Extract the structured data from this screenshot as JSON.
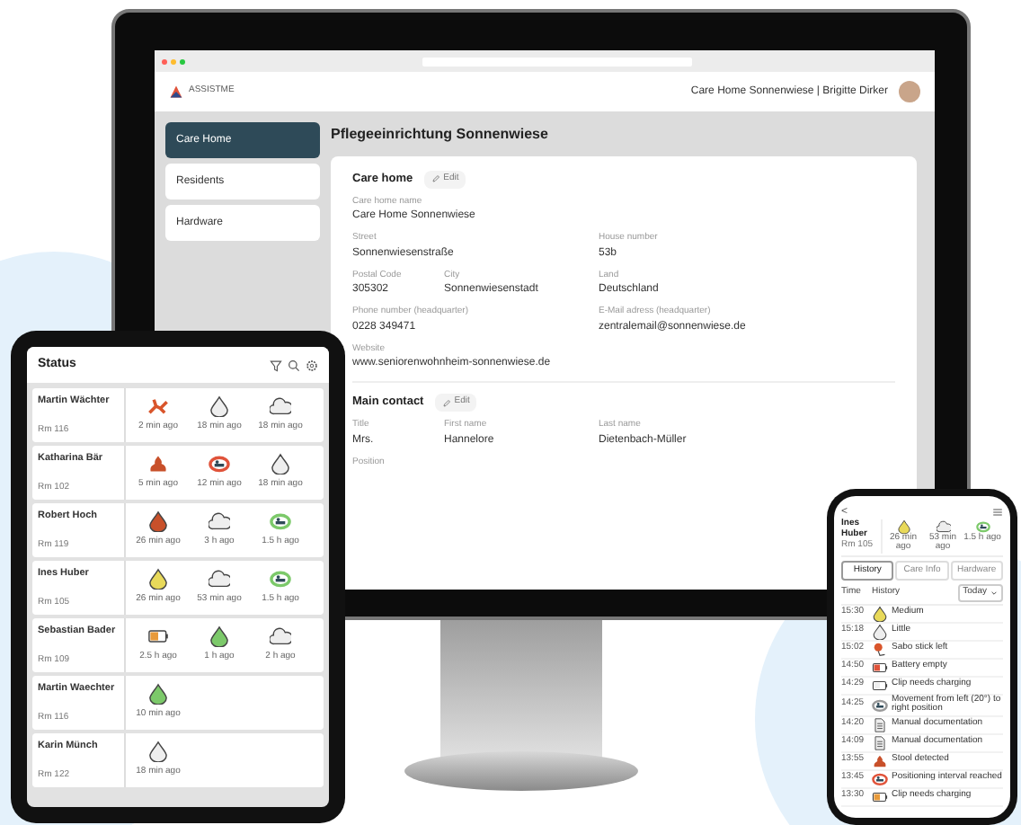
{
  "desktop": {
    "brand": "ASSISTME",
    "account": "Care Home Sonnenwiese | Brigitte Dirker",
    "sidebar": [
      {
        "label": "Care Home",
        "selected": true
      },
      {
        "label": "Residents",
        "selected": false
      },
      {
        "label": "Hardware",
        "selected": false
      }
    ],
    "title": "Pflegeeinrichtung Sonnenwiese",
    "sections": [
      {
        "heading": "Care home",
        "edit": "Edit",
        "rows": [
          [
            {
              "label": "Care home name",
              "value": "Care Home Sonnenwiese"
            }
          ],
          [
            {
              "label": "Street",
              "value": "Sonnenwiesenstraße"
            },
            {
              "label": "House number",
              "value": "53b"
            }
          ],
          [
            {
              "label": "Postal Code",
              "value": "305302"
            },
            {
              "label": "City",
              "value": "Sonnenwiesenstadt"
            },
            {
              "label": "Land",
              "value": "Deutschland"
            }
          ],
          [
            {
              "label": "Phone number (headquarter)",
              "value": "0228 349471"
            },
            {
              "label": "E-Mail adress (headquarter)",
              "value": "zentralemail@sonnenwiese.de"
            }
          ],
          [
            {
              "label": "Website",
              "value": "www.seniorenwohnheim-sonnenwiese.de"
            }
          ]
        ]
      },
      {
        "heading": "Main contact",
        "edit": "Edit",
        "rows": [
          [
            {
              "label": "Title",
              "value": "Mrs."
            },
            {
              "label": "First name",
              "value": "Hannelore"
            },
            {
              "label": "Last name",
              "value": "Dietenbach-Müller"
            }
          ],
          [
            {
              "label": "Position"
            }
          ]
        ]
      }
    ]
  },
  "tablet": {
    "title": "Status",
    "residents": [
      {
        "name": "Martin Wächter",
        "room": "Rm 116",
        "events": [
          {
            "kind": "fall",
            "color": "#d9552b",
            "time": "2 min ago"
          },
          {
            "kind": "drop",
            "color": "#eeeeee",
            "time": "18 min ago"
          },
          {
            "kind": "cloud",
            "color": "#eeeeee",
            "time": "18 min ago"
          }
        ]
      },
      {
        "name": "Katharina Bär",
        "room": "Rm 102",
        "events": [
          {
            "kind": "pile",
            "color": "#c8502a",
            "time": "5 min ago"
          },
          {
            "kind": "bed",
            "color": "#e0533a",
            "time": "12 min ago"
          },
          {
            "kind": "drop",
            "color": "#eeeeee",
            "time": "18 min ago"
          }
        ]
      },
      {
        "name": "Robert Hoch",
        "room": "Rm 119",
        "events": [
          {
            "kind": "drop",
            "color": "#c8502a",
            "time": "26 min ago"
          },
          {
            "kind": "cloud",
            "color": "#eeeeee",
            "time": "3 h ago"
          },
          {
            "kind": "bed",
            "color": "#7cc96a",
            "time": "1.5 h ago"
          }
        ]
      },
      {
        "name": "Ines Huber",
        "room": "Rm 105",
        "events": [
          {
            "kind": "drop",
            "color": "#e8d95a",
            "time": "26 min ago"
          },
          {
            "kind": "cloud",
            "color": "#eeeeee",
            "time": "53 min ago"
          },
          {
            "kind": "bed",
            "color": "#7cc96a",
            "time": "1.5 h ago"
          }
        ]
      },
      {
        "name": "Sebastian Bader",
        "room": "Rm 109",
        "events": [
          {
            "kind": "battery",
            "color": "#e89a3a",
            "time": "2.5 h ago"
          },
          {
            "kind": "drop",
            "color": "#7cc96a",
            "time": "1 h ago"
          },
          {
            "kind": "cloud",
            "color": "#eeeeee",
            "time": "2 h ago"
          }
        ]
      },
      {
        "name": "Martin Waechter",
        "room": "Rm 116",
        "events": [
          {
            "kind": "drop",
            "color": "#7cc96a",
            "time": "10 min ago"
          }
        ]
      },
      {
        "name": "Karin Münch",
        "room": "Rm 122",
        "events": [
          {
            "kind": "drop",
            "color": "#eeeeee",
            "time": "18 min ago"
          }
        ]
      }
    ]
  },
  "phone": {
    "back": "<",
    "name": "Ines Huber",
    "room": "Rm 105",
    "events": [
      {
        "kind": "drop",
        "color": "#e8d95a",
        "time": "26 min ago"
      },
      {
        "kind": "cloud",
        "color": "#eeeeee",
        "time": "53 min ago"
      },
      {
        "kind": "bed",
        "color": "#7cc96a",
        "time": "1.5 h ago"
      }
    ],
    "tabs": [
      {
        "label": "History",
        "selected": true
      },
      {
        "label": "Care Info",
        "selected": false
      },
      {
        "label": "Hardware",
        "selected": false
      }
    ],
    "columns": [
      "Time",
      "History"
    ],
    "filter": "Today",
    "history": [
      {
        "time": "15:30",
        "kind": "drop",
        "color": "#e8d95a",
        "text": "Medium"
      },
      {
        "time": "15:18",
        "kind": "drop",
        "color": "#eeeeee",
        "text": "Little"
      },
      {
        "time": "15:02",
        "kind": "pin",
        "color": "#d9552b",
        "text": "Sabo stick left"
      },
      {
        "time": "14:50",
        "kind": "battery",
        "color": "#e0533a",
        "text": "Battery empty"
      },
      {
        "time": "14:29",
        "kind": "battery",
        "color": "#eeeeee",
        "text": "Clip needs charging"
      },
      {
        "time": "14:25",
        "kind": "bed",
        "color": "#999999",
        "text": "Movement from left (20°) to right position"
      },
      {
        "time": "14:20",
        "kind": "doc",
        "color": "#eeeeee",
        "text": "Manual documentation"
      },
      {
        "time": "14:09",
        "kind": "doc",
        "color": "#eeeeee",
        "text": "Manual documentation"
      },
      {
        "time": "13:55",
        "kind": "pile",
        "color": "#c8502a",
        "text": "Stool detected"
      },
      {
        "time": "13:45",
        "kind": "bed",
        "color": "#e0533a",
        "text": "Positioning interval reached"
      },
      {
        "time": "13:30",
        "kind": "battery",
        "color": "#e89a3a",
        "text": "Clip needs charging"
      }
    ]
  }
}
